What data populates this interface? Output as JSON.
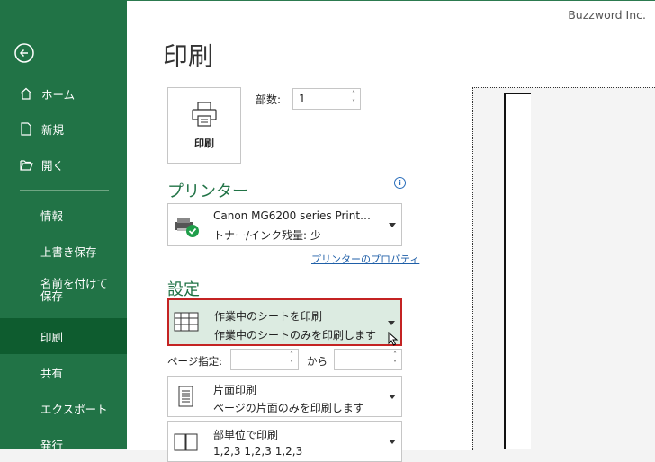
{
  "sidebar": {
    "items": [
      {
        "label": "ホーム",
        "icon": "home-icon"
      },
      {
        "label": "新規",
        "icon": "new-file-icon"
      },
      {
        "label": "開く",
        "icon": "folder-open-icon"
      },
      {
        "label": "情報"
      },
      {
        "label": "上書き保存"
      },
      {
        "label": "名前を付けて保存"
      },
      {
        "label": "印刷"
      },
      {
        "label": "共有"
      },
      {
        "label": "エクスポート"
      },
      {
        "label": "発行"
      }
    ],
    "active": "印刷"
  },
  "watermark": "Buzzword Inc.",
  "title": "印刷",
  "print_button_label": "印刷",
  "copies": {
    "label": "部数:",
    "value": "1"
  },
  "printer": {
    "heading": "プリンター",
    "name": "Canon MG6200 series Print…",
    "status": "トナー/インク残量: 少",
    "properties_link": "プリンターのプロパティ"
  },
  "settings": {
    "heading": "設定",
    "scope": {
      "title": "作業中のシートを印刷",
      "desc": "作業中のシートのみを印刷します"
    },
    "pages": {
      "label": "ページ指定:",
      "from_value": "",
      "to_label": "から",
      "to_value": ""
    },
    "sides": {
      "title": "片面印刷",
      "desc": "ページの片面のみを印刷します"
    },
    "collate": {
      "title": "部単位で印刷",
      "desc": "1,2,3 1,2,3 1,2,3"
    }
  },
  "colors": {
    "accent": "#217346",
    "active_nav": "#0e5c2f",
    "highlight_border": "#c42323"
  }
}
